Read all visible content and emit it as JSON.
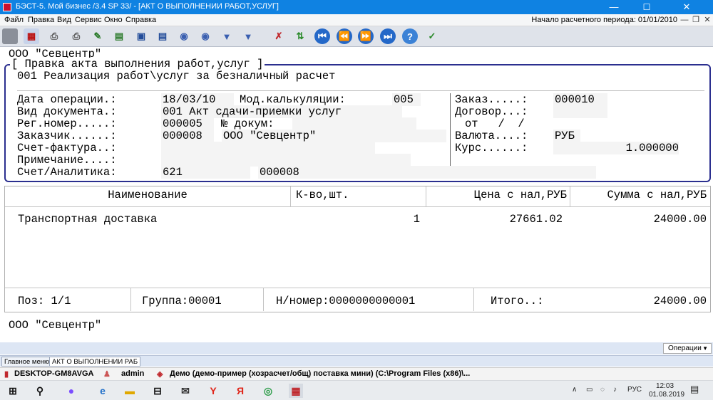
{
  "window": {
    "title": "БЭСТ-5. Мой бизнес /3.4 SP 33/ - [АКТ О ВЫПОЛНЕНИИ РАБОТ,УСЛУГ]",
    "minimize": "—",
    "maximize": "☐",
    "close": "✕"
  },
  "menu": {
    "items": [
      "Файл",
      "Правка",
      "Вид",
      "Сервис",
      "Окно",
      "Справка"
    ],
    "period": "Начало расчетного периода: 01/01/2010",
    "inner_buttons": [
      "—",
      "❐",
      "✕"
    ]
  },
  "toolbar": {
    "icons": [
      "exit-icon",
      "calculator-icon",
      "print-icon",
      "print-preview-icon",
      "edit-icon",
      "add-row-icon",
      "save-icon",
      "copy-icon",
      "group-icon",
      "cut-icon",
      "filter-icon",
      "filter-menu-icon",
      "delete-icon",
      "sort-icon",
      "first-record-icon",
      "prev-record-icon",
      "next-record-icon",
      "last-record-icon",
      "help-icon",
      "document-check-icon"
    ]
  },
  "header": {
    "org": "ООО \"Севцентр\""
  },
  "form": {
    "frame_title": "[ Правка акта выполнения работ,услуг ]",
    "operation": "001 Реализация работ\\услуг за безналичный расчет",
    "labels": {
      "date": "Дата операции.:",
      "calc_mode": "Мод.калькуляции:",
      "doc_type": "Вид документа.:",
      "reg_number": "Рег.номер.....:",
      "doc_number": "№ докум:",
      "customer": "Заказчик......:",
      "invoice": "Счет-фактура..:",
      "note": "Примечание....:",
      "account": "Счет/Аналитика:",
      "order": "Заказ.....:",
      "contract": "Договор...:",
      "from": "от   /  /",
      "currency": "Валюта....:",
      "rate": "Курс......:"
    },
    "values": {
      "date": "18/03/10",
      "calc_mode": "005",
      "doc_type": "001 Акт сдачи-приемки услуг",
      "reg_number": "000005",
      "doc_number": "",
      "customer_code": "000008",
      "customer_name": "ООО \"Севцентр\"",
      "invoice": "",
      "note": "",
      "account": "621",
      "analytics": "000008",
      "order": "000010",
      "contract": "",
      "currency": "РУБ",
      "rate": "1.000000"
    }
  },
  "table": {
    "columns": [
      "Наименование",
      "К-во,шт.",
      "Цена с нал,РУБ",
      "Сумма с нал,РУБ"
    ],
    "rows": [
      {
        "name": "Транспортная доставка",
        "qty": "1",
        "price": "27661.02",
        "sum": "24000.00"
      }
    ],
    "footer": {
      "pos": "Поз: 1/1",
      "group": "Группа:00001",
      "nnumber": "Н/номер:0000000000001",
      "total_label": "Итого..:",
      "total": "24000.00"
    }
  },
  "status": {
    "org": "ООО \"Севцентр\"",
    "operations": "Операции"
  },
  "window_tabs": [
    "Главное меню",
    "АКТ О ВЫПОЛНЕНИИ РАБ"
  ],
  "remote_bar": {
    "host": "DESKTOP-GM8AVGA",
    "user": "admin",
    "session": "Демо (демо-пример (хозрасчет/общ) поставка мини) (C:\\Program Files (x86)\\..."
  },
  "taskbar": {
    "language": "РУС",
    "time": "12:03",
    "date": "01.08.2019"
  }
}
